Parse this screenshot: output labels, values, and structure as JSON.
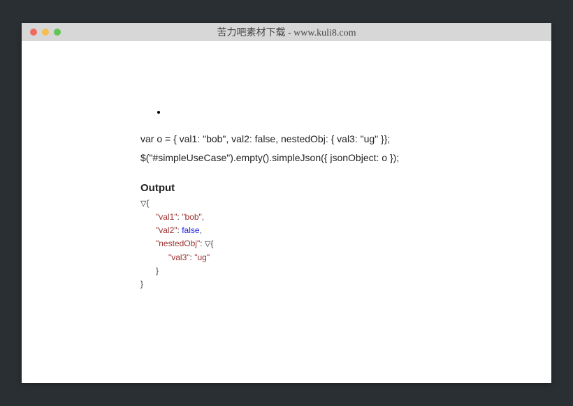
{
  "titlebar": {
    "title": "苦力吧素材下载 - www.kuli8.com"
  },
  "code": {
    "line1": "var o = { val1: \"bob\", val2: false, nestedObj: { val3: \"ug\" }};",
    "line2": "$(\"#simpleUseCase\").empty().simpleJson({ jsonObject: o });"
  },
  "output": {
    "heading": "Output",
    "toggle": "▽",
    "openBrace": "{",
    "closeBrace": "}",
    "comma": ",",
    "colon": ": ",
    "keys": {
      "val1": "\"val1\"",
      "val2": "\"val2\"",
      "nestedObj": "\"nestedObj\"",
      "val3": "\"val3\""
    },
    "values": {
      "val1": "\"bob\"",
      "val2": "false",
      "val3": "\"ug\""
    }
  }
}
